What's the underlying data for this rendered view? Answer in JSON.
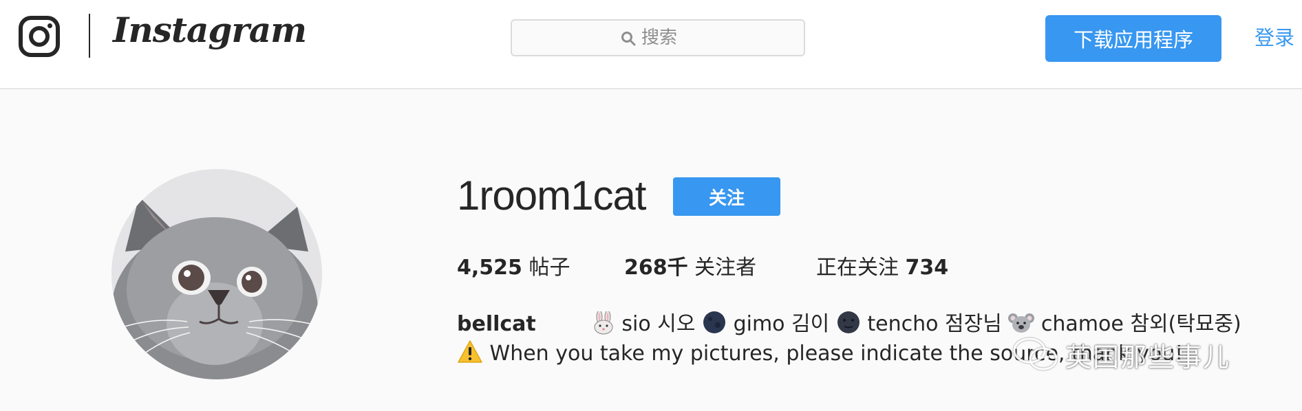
{
  "header": {
    "brand_wordmark": "Instagram",
    "search": {
      "placeholder": "搜索"
    },
    "download_label": "下载应用程序",
    "login_label": "登录"
  },
  "profile": {
    "username": "1room1cat",
    "follow_label": "关注",
    "stats": {
      "posts_value": "4,525",
      "posts_label": "帖子",
      "followers_value": "268千",
      "followers_label": "关注者",
      "following_label": "正在关注",
      "following_value": "734"
    },
    "bio": {
      "name": "bellcat",
      "cats": [
        {
          "emoji": "rabbit-face-icon",
          "text": "sio 시오"
        },
        {
          "emoji": "dark-moon-icon",
          "text": "gimo 김이"
        },
        {
          "emoji": "new-moon-face-icon",
          "text": "tencho 점장님"
        },
        {
          "emoji": "koala-icon",
          "text": "chamoe 참외(탁묘중)"
        }
      ],
      "warning_icon": "warning-icon",
      "line2": "When you take my pictures, please indicate the source, thank you!"
    }
  },
  "watermark": {
    "text": "英国那些事儿"
  }
}
